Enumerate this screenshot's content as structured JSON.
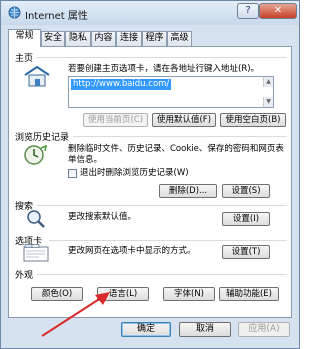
{
  "window": {
    "title": "Internet 属性",
    "help_label": "?",
    "close_label": "✕"
  },
  "tabs": [
    {
      "label": "常规",
      "active": true
    },
    {
      "label": "安全"
    },
    {
      "label": "隐私"
    },
    {
      "label": "内容"
    },
    {
      "label": "连接"
    },
    {
      "label": "程序"
    },
    {
      "label": "高级"
    }
  ],
  "homepage": {
    "title": "主页",
    "description": "若要创建主页选项卡，请在各地址行键入地址(R)。",
    "url": "http://www.baidu.com/",
    "buttons": {
      "use_current": "使用当前页(C)",
      "use_default": "使用默认值(F)",
      "use_blank": "使用空白页(B)"
    }
  },
  "history": {
    "title": "浏览历史记录",
    "description_line1": "删除临时文件、历史记录、Cookie、保存的密码和网页表",
    "description_line2": "单信息。",
    "checkbox_label": "退出时删除浏览历史记录(W)",
    "checkbox_checked": false,
    "delete_button": "删除(D)...",
    "settings_button": "设置(S)"
  },
  "search": {
    "title": "搜索",
    "description": "更改搜索默认值。",
    "settings_button": "设置(I)"
  },
  "tabs_section": {
    "title": "选项卡",
    "description": "更改网页在选项卡中显示的方式。",
    "settings_button": "设置(T)"
  },
  "appearance": {
    "title": "外观",
    "buttons": {
      "colors": "颜色(O)",
      "languages": "语言(L)",
      "fonts": "字体(N)",
      "accessibility": "辅助功能(E)"
    }
  },
  "footer": {
    "ok": "确定",
    "cancel": "取消",
    "apply": "应用(A)"
  },
  "icons": {
    "title": "internet-globe-icon",
    "homepage": "house-icon",
    "history": "history-clock-icon",
    "search": "magnifier-icon",
    "tabs": "tabs-window-icon",
    "annotation": "red-arrow-icon"
  },
  "colors": {
    "accent": "#3399ff",
    "annotation": "#d92b2b"
  }
}
